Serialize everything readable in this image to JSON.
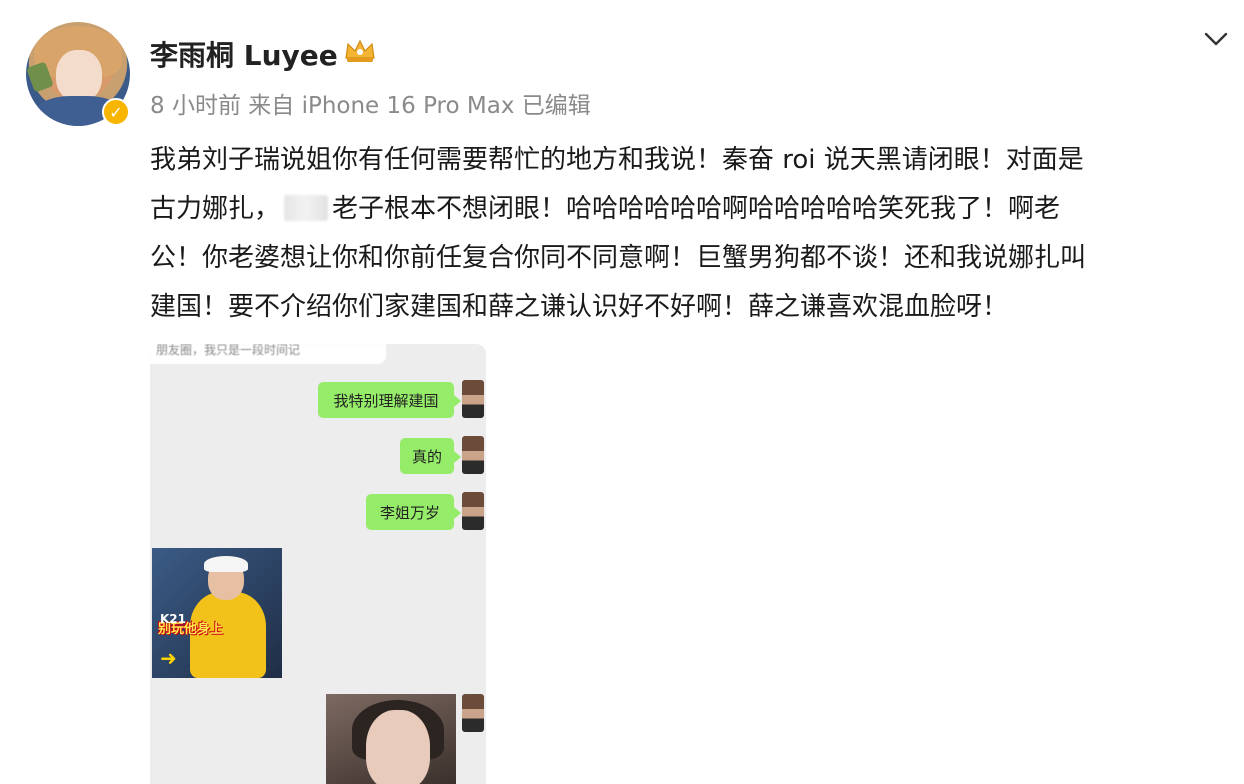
{
  "post": {
    "username": "李雨桐 Luyee",
    "meta": "8 小时前  来自 iPhone 16 Pro Max 已编辑",
    "text_line1": "我弟刘子瑞说姐你有任何需要帮忙的地方和我说！秦奋 roi 说天黑请闭眼！对面是",
    "text_line2a": "古力娜扎，",
    "text_line2b": "老子根本不想闭眼！哈哈哈哈哈哈啊哈哈哈哈哈笑死我了！啊老",
    "text_line3": "公！你老婆想让你和你前任复合你同不同意啊！巨蟹男狗都不谈！还和我说娜扎叫",
    "text_line4": "建国！要不介绍你们家建国和薛之谦认识好不好啊！薛之谦喜欢混血脸呀！"
  },
  "chat": {
    "top_snippet": "朋友圈，我只是一段时间记",
    "messages": [
      "我特别理解建国",
      "真的",
      "李姐万岁"
    ],
    "sticker_caption": "别玩他身上",
    "sticker_label": "K21"
  },
  "colors": {
    "bubble": "#95ec69",
    "badge": "#f7b500",
    "meta": "#8a8a8a"
  },
  "icons": {
    "verified": "verified-badge-icon",
    "crown": "crown-icon",
    "more": "chevron-down-icon"
  }
}
